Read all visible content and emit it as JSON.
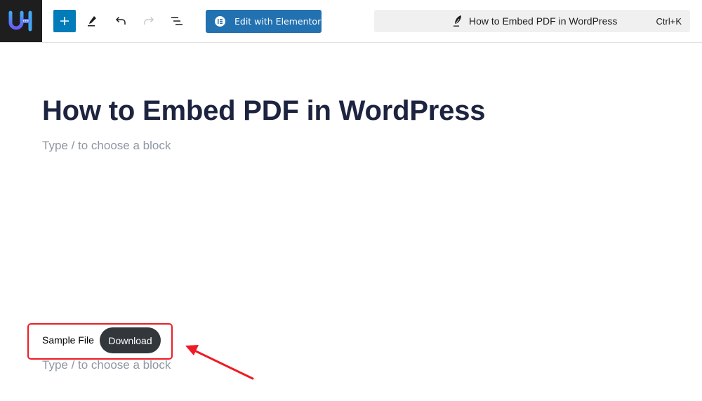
{
  "toolbar": {
    "logo_text": "UH",
    "icons": {
      "add": "plus-icon",
      "tools": "pen-icon",
      "undo": "undo-icon",
      "redo": "redo-icon",
      "document_overview": "list-view-icon"
    },
    "edit_with_elementor_label": "Edit with Elementor",
    "command_bar": {
      "title": "How to Embed PDF in WordPress",
      "shortcut": "Ctrl+K"
    }
  },
  "editor": {
    "post_title": "How to Embed PDF in WordPress",
    "block_placeholder": "Type / to choose a block",
    "file_block": {
      "file_name": "Sample File",
      "download_label": "Download"
    }
  },
  "colors": {
    "primary_blue": "#007cba",
    "elementor_blue": "#2271b1",
    "title_color": "#1d2440",
    "download_button": "#32373c",
    "annotation_red": "#ee1b24"
  }
}
